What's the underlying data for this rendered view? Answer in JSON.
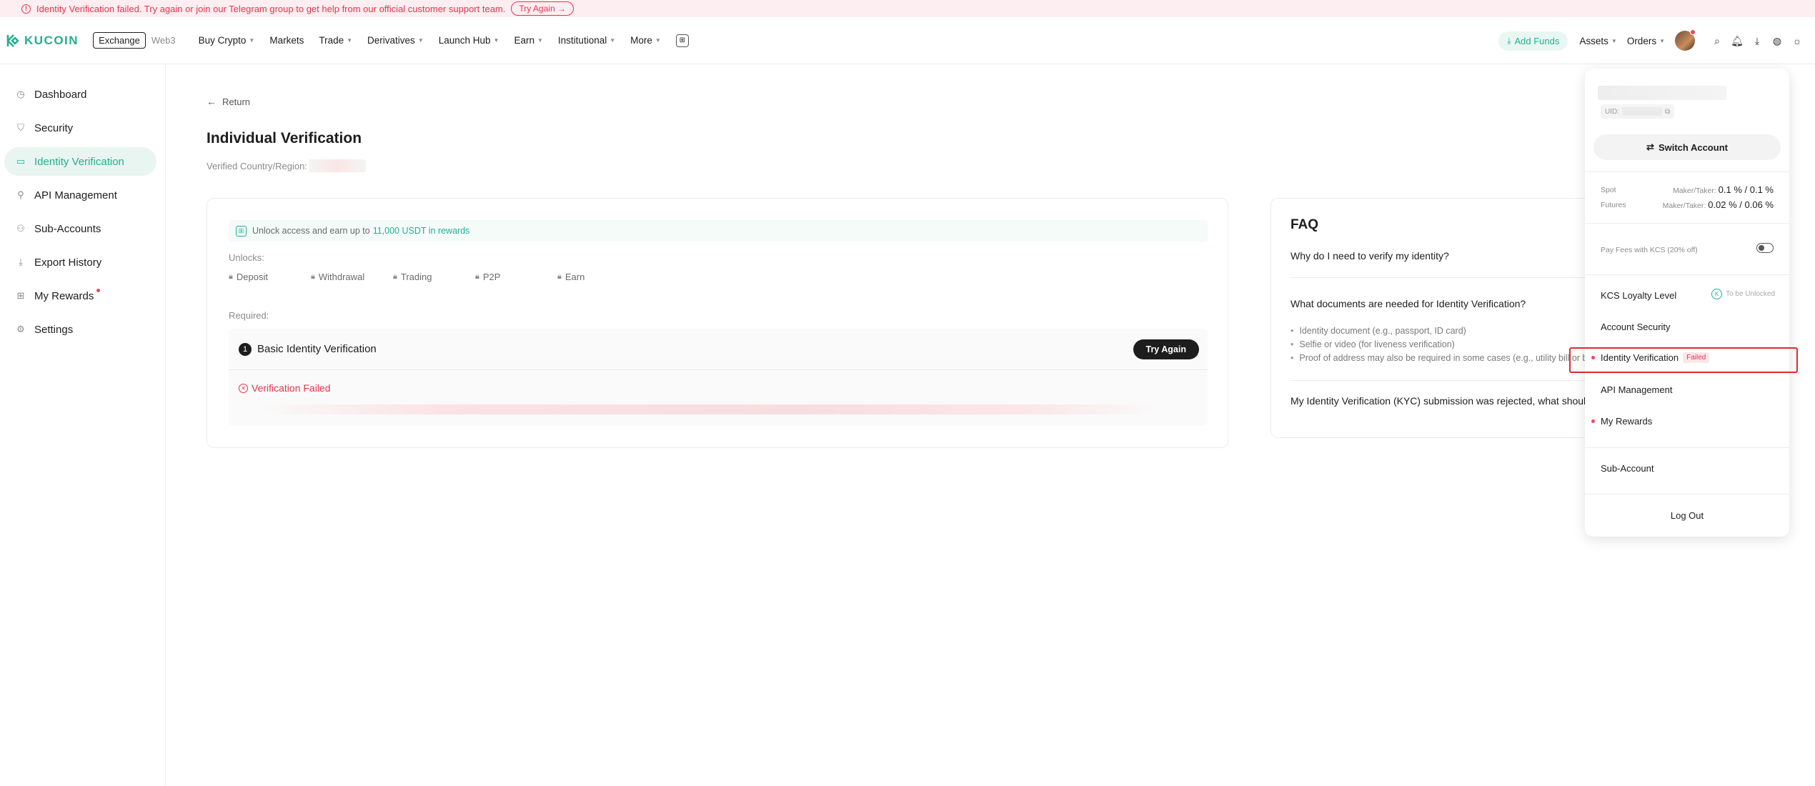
{
  "alert": {
    "message": "Identity Verification failed. Try again or join our Telegram group to get help from our official customer support team.",
    "button": "Try Again →"
  },
  "nav": {
    "logo": "KUCOIN",
    "exchange": "Exchange",
    "web3": "Web3",
    "items": [
      "Buy Crypto",
      "Markets",
      "Trade",
      "Derivatives",
      "Launch Hub",
      "Earn",
      "Institutional",
      "More"
    ],
    "add_funds": "Add Funds",
    "assets": "Assets",
    "orders": "Orders"
  },
  "sidebar": {
    "items": [
      {
        "label": "Dashboard",
        "icon": "clock-icon"
      },
      {
        "label": "Security",
        "icon": "shield-icon"
      },
      {
        "label": "Identity Verification",
        "icon": "id-card-icon"
      },
      {
        "label": "API Management",
        "icon": "api-icon"
      },
      {
        "label": "Sub-Accounts",
        "icon": "users-icon"
      },
      {
        "label": "Export History",
        "icon": "download-icon"
      },
      {
        "label": "My Rewards",
        "icon": "gift-icon"
      },
      {
        "label": "Settings",
        "icon": "gear-icon"
      }
    ]
  },
  "main": {
    "return": "Return",
    "title": "Individual Verification",
    "country_label": "Verified Country/Region:",
    "promo_prefix": "Unlock access and earn up to",
    "promo_amount": "11,000 USDT in rewards",
    "unlocks_label": "Unlocks:",
    "unlocks": [
      "Deposit",
      "Withdrawal",
      "Trading",
      "P2P",
      "Earn"
    ],
    "required_label": "Required:",
    "step_number": "1",
    "step_title": "Basic Identity Verification",
    "try_again": "Try Again",
    "failed": "Verification Failed"
  },
  "faq": {
    "title": "FAQ",
    "q1": "Why do I need to verify my identity?",
    "q2": "What documents are needed for Identity Verification?",
    "answers": [
      "Identity document (e.g., passport, ID card)",
      "Selfie or video (for liveness verification)",
      "Proof of address may also be required in some cases (e.g., utility bill or b"
    ],
    "q3": "My Identity Verification (KYC) submission was rejected, what should"
  },
  "dropdown": {
    "uid_label": "UID:",
    "switch_account": "Switch Account",
    "spot_label": "Spot",
    "spot_maker_label": "Maker/Taker:",
    "spot_fee": "0.1 % / 0.1 %",
    "futures_label": "Futures",
    "futures_maker_label": "Maker/Taker:",
    "futures_fee": "0.02 % / 0.06 %",
    "pay_fees": "Pay Fees with KCS (20% off)",
    "loyalty": "KCS Loyalty Level",
    "loyalty_status": "To be Unlocked",
    "account_security": "Account Security",
    "identity_verification": "Identity Verification",
    "failed_badge": "Failed",
    "api_management": "API Management",
    "my_rewards": "My Rewards",
    "sub_account": "Sub-Account",
    "logout": "Log Out"
  },
  "colors": {
    "accent": "#23af91",
    "error": "#e7334f",
    "highlight": "#e0292f"
  }
}
